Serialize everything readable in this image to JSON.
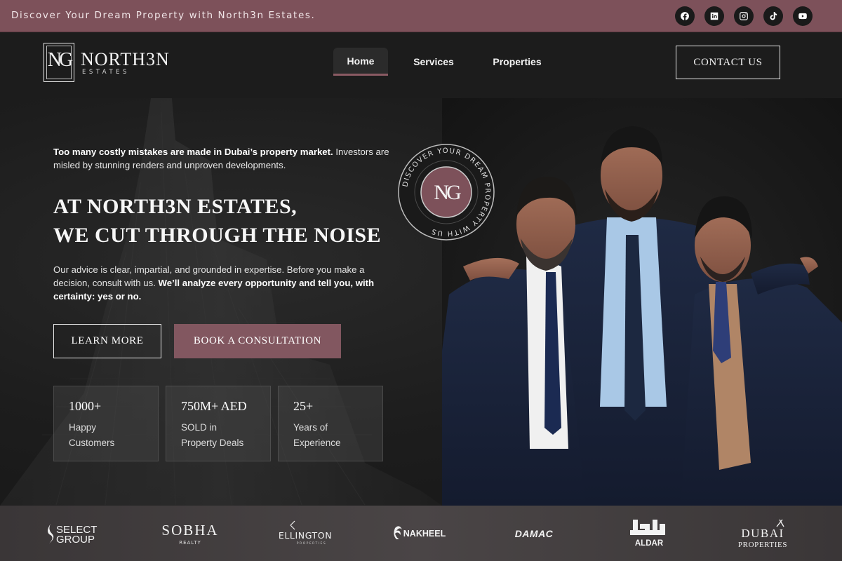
{
  "topbar": {
    "tagline": "Discover Your Dream Property with North3n Estates.",
    "social": [
      "facebook-icon",
      "linkedin-icon",
      "instagram-icon",
      "tiktok-icon",
      "youtube-icon"
    ]
  },
  "brand": {
    "name": "NORTH3N",
    "sub": "ESTATES",
    "monogram": "NG"
  },
  "nav": {
    "items": [
      {
        "label": "Home",
        "active": true
      },
      {
        "label": "Services",
        "active": false
      },
      {
        "label": "Properties",
        "active": false
      }
    ],
    "contact_label": "CONTACT US"
  },
  "hero": {
    "intro_bold": "Too many costly mistakes are made in Dubai’s property market.",
    "intro_rest": " Investors are misled by stunning renders and unproven developments.",
    "headline_line1": "AT NORTH3N ESTATES,",
    "headline_line2": "WE CUT THROUGH THE NOISE",
    "desc_plain": "Our advice is clear, impartial, and grounded in expertise. Before you make a decision,  consult with us. ",
    "desc_bold": "We’ll analyze every opportunity and tell you, with certainty: yes or no.",
    "learn_more": "LEARN MORE",
    "book": "BOOK A CONSULTATION",
    "badge_text": "DISCOVER YOUR DREAM PROPERTY WITH US"
  },
  "stats": [
    {
      "value": "1000+",
      "label_line1": "Happy",
      "label_line2": "Customers"
    },
    {
      "value": "750M+ AED",
      "label_line1": "SOLD in",
      "label_line2": "Property Deals"
    },
    {
      "value": "25+",
      "label_line1": "Years of",
      "label_line2": "Experience"
    }
  ],
  "partners": {
    "select_1": "SELECT",
    "select_2": "GROUP",
    "sobha_1": "SOBHA",
    "sobha_2": "REALTY",
    "ellington_1": "ELLINGTON",
    "ellington_2": "PROPERTIES",
    "nakheel": "NAKHEEL",
    "damac": "DAMAC",
    "aldar": "ALDAR",
    "dubai_1": "DUBAI",
    "dubai_2": "PROPERTIES"
  },
  "colors": {
    "accent": "#825760",
    "topbar": "#7d515a",
    "background": "#161616"
  }
}
